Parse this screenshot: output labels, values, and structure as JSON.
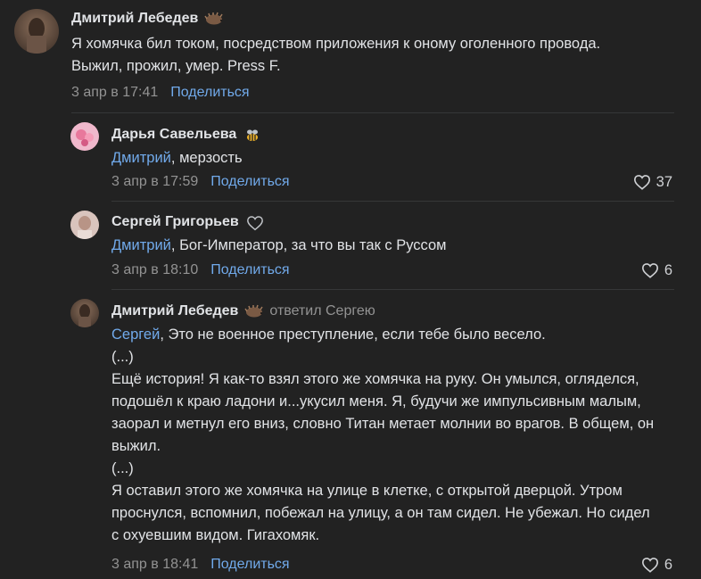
{
  "colors": {
    "background": "#222222",
    "text": "#e1e3e6",
    "secondary": "#939393",
    "link": "#71aaeb",
    "divider": "#363738"
  },
  "comments": [
    {
      "author": "Дмитрий Лебедев",
      "badge_icon": "hedgehog-badge-icon",
      "text": "Я хомячка бил током, посредством приложения к оному оголенного провода. Выжил, прожил, умер. Press F.",
      "date": "3 апр в 17:41",
      "share": "Поделиться"
    },
    {
      "author": "Дарья Савельева",
      "badge_icon": "bee-badge-icon",
      "mention": "Дмитрий",
      "text": ", мерзость",
      "date": "3 апр в 17:59",
      "share": "Поделиться",
      "likes": "37"
    },
    {
      "author": "Сергей Григорьев",
      "badge_icon": "heart-outline-badge-icon",
      "mention": "Дмитрий",
      "text": ", Бог-Император, за что вы так с Руссом",
      "date": "3 апр в 18:10",
      "share": "Поделиться",
      "likes": "6"
    },
    {
      "author": "Дмитрий Лебедев",
      "badge_icon": "hedgehog-badge-icon",
      "replied_to": "ответил Сергею",
      "mention": "Сергей",
      "text": ", Это не военное преступление, если тебе было весело.\n(...)\nЕщё история! Я как-то взял этого же хомячка на руку. Он умылся, огляделся, подошёл к краю ладони и...укусил меня. Я, будучи же импульсивным малым, заорал и метнул его вниз, словно Титан метает молнии во врагов. В общем, он выжил.\n(...)\nЯ оставил этого же хомячка на улице в клетке, с открытой дверцой. Утром проснулся, вспомнил, побежал на улицу, а он там сидел. Не убежал. Но сидел с охуевшим видом. Гигахомяк.",
      "date": "3 апр в 18:41",
      "share": "Поделиться",
      "likes": "6"
    }
  ]
}
